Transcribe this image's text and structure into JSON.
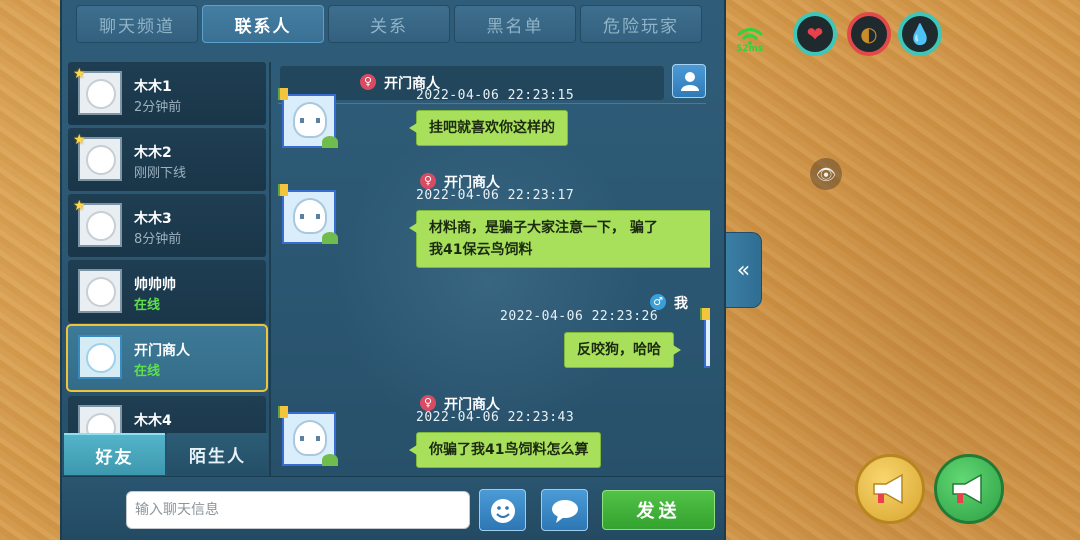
{
  "tabs": [
    {
      "label": "聊天频道",
      "active": false
    },
    {
      "label": "联系人",
      "active": true
    },
    {
      "label": "关系",
      "active": false
    },
    {
      "label": "黑名单",
      "active": false
    },
    {
      "label": "危险玩家",
      "active": false
    }
  ],
  "contacts": [
    {
      "name": "木木1",
      "status": "2分钟前",
      "starred": true,
      "online": false
    },
    {
      "name": "木木2",
      "status": "刚刚下线",
      "starred": true,
      "online": false
    },
    {
      "name": "木木3",
      "status": "8分钟前",
      "starred": true,
      "online": false
    },
    {
      "name": "帅帅帅",
      "status": "在线",
      "starred": false,
      "online": true
    },
    {
      "name": "开门商人",
      "status": "在线",
      "starred": false,
      "online": true,
      "selected": true
    },
    {
      "name": "木木4",
      "status": "在线",
      "starred": false,
      "online": true
    }
  ],
  "friend_tabs": {
    "friends": "好友",
    "strangers": "陌生人"
  },
  "chat": {
    "header_name": "开门商人",
    "messages": [
      {
        "sender": "开门商人",
        "time": "2022-04-06  22:23:15",
        "text": "挂吧就喜欢你这样的",
        "mine": false
      },
      {
        "sender": "开门商人",
        "time": "2022-04-06  22:23:17",
        "text_line1": "材料商，是骗子大家注意一下，  骗了",
        "text_line2": "我41保云鸟饲料",
        "mine": false
      },
      {
        "sender": "我",
        "time": "2022-04-06  22:23:26",
        "text": "反咬狗，哈哈",
        "mine": true
      },
      {
        "sender": "开门商人",
        "time": "2022-04-06  22:23:43",
        "text": "你骗了我41鸟饲料怎么算",
        "mine": false
      }
    ]
  },
  "input": {
    "placeholder": "输入聊天信息",
    "value": "",
    "send_label": "发送"
  },
  "hud": {
    "ping": "52ms",
    "icons": [
      "wifi-icon",
      "heart-icon",
      "hunger-icon",
      "water-icon"
    ]
  },
  "colors": {
    "accent": "#a8e05c",
    "panel": "#2f5d79",
    "selected_border": "#f0c43a",
    "online": "#5ee04c"
  }
}
